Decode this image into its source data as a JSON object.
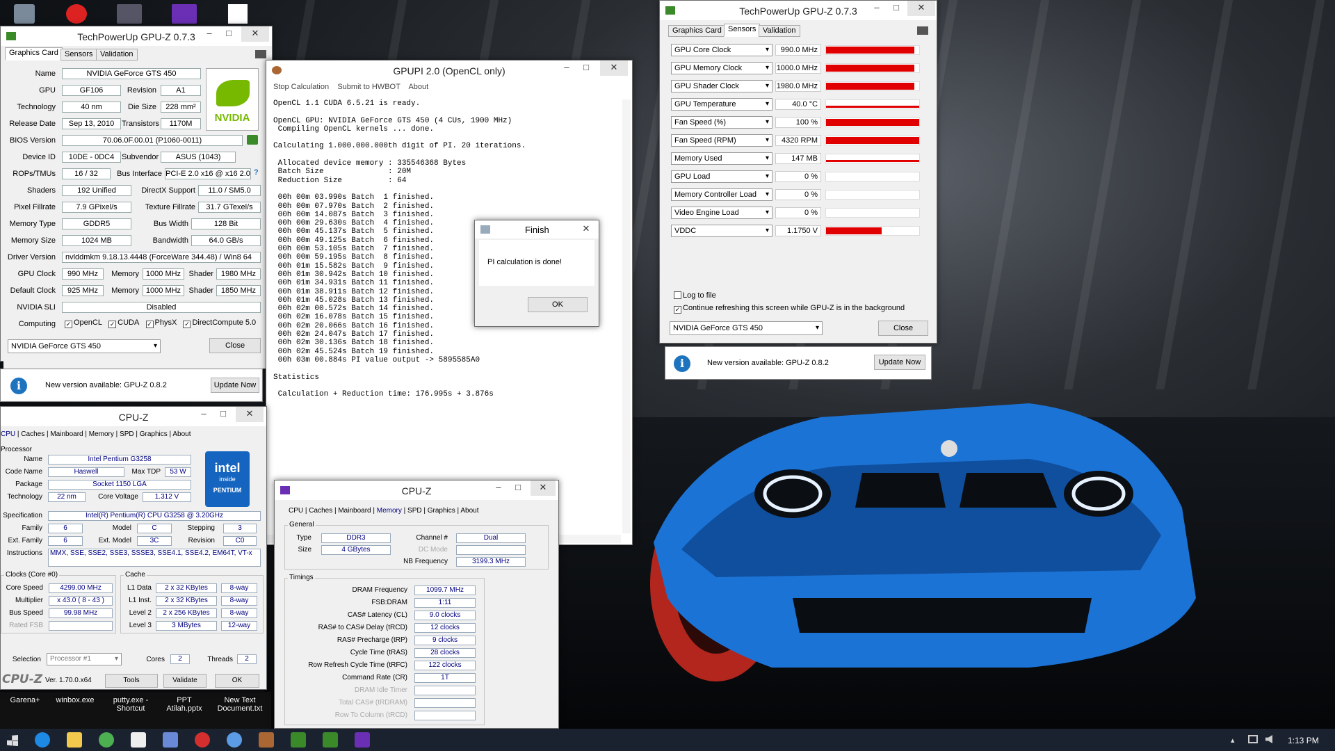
{
  "desktop": {
    "icons": [
      "Garena+",
      "winbox.exe",
      "putty.exe - Shortcut",
      "PPT Atilah.pptx",
      "New Text Document.txt"
    ]
  },
  "gpuz_left": {
    "title": "TechPowerUp GPU-Z 0.7.3",
    "tabs": [
      "Graphics Card",
      "Sensors",
      "Validation"
    ],
    "name": "NVIDIA GeForce GTS 450",
    "gpu": "GF106",
    "revision": "A1",
    "technology": "40 nm",
    "die_size": "228 mm²",
    "release_date": "Sep 13, 2010",
    "transistors": "1170M",
    "bios": "70.06.0F.00.01 (P1060-0011)",
    "device_id": "10DE - 0DC4",
    "subvendor": "ASUS (1043)",
    "rops": "16 / 32",
    "bus_interface": "PCI-E 2.0 x16 @ x16 2.0",
    "shaders": "192 Unified",
    "directx": "11.0 / SM5.0",
    "pixel_fillrate": "7.9 GPixel/s",
    "texture_fillrate": "31.7 GTexel/s",
    "memory_type": "GDDR5",
    "bus_width": "128 Bit",
    "memory_size": "1024 MB",
    "bandwidth": "64.0 GB/s",
    "driver": "nvlddmkm 9.18.13.4448 (ForceWare 344.48) / Win8 64",
    "gpu_clock": "990 MHz",
    "mem_clock": "1000 MHz",
    "shader_clock": "1980 MHz",
    "def_clock": "925 MHz",
    "def_mem": "1000 MHz",
    "def_shader": "1850 MHz",
    "sli": "Disabled",
    "labels": {
      "name": "Name",
      "gpu": "GPU",
      "revision": "Revision",
      "technology": "Technology",
      "die": "Die Size",
      "release": "Release Date",
      "transistors": "Transistors",
      "bios": "BIOS Version",
      "device": "Device ID",
      "subvendor": "Subvendor",
      "rops": "ROPs/TMUs",
      "bus": "Bus Interface",
      "shaders": "Shaders",
      "directx": "DirectX Support",
      "pixel": "Pixel Fillrate",
      "texture": "Texture Fillrate",
      "memtype": "Memory Type",
      "buswidth": "Bus Width",
      "memsize": "Memory Size",
      "bandwidth": "Bandwidth",
      "driver": "Driver Version",
      "gpuclock": "GPU Clock",
      "memory": "Memory",
      "shader": "Shader",
      "default": "Default Clock",
      "sli": "NVIDIA SLI",
      "computing": "Computing"
    },
    "computing": [
      "OpenCL",
      "CUDA",
      "PhysX",
      "DirectCompute 5.0"
    ],
    "selected": "NVIDIA GeForce GTS 450",
    "close": "Close",
    "update_text": "New version available: GPU-Z 0.8.2",
    "update_btn": "Update Now"
  },
  "gpupi": {
    "title": "GPUPI 2.0 (OpenCL only)",
    "menu": [
      "Stop Calculation",
      "Submit to HWBOT",
      "About"
    ],
    "log": "OpenCL 1.1 CUDA 6.5.21 is ready.\n\nOpenCL GPU: NVIDIA GeForce GTS 450 (4 CUs, 1900 MHz)\n Compiling OpenCL kernels ... done.\n\nCalculating 1.000.000.000th digit of PI. 20 iterations.\n\n Allocated device memory : 335546368 Bytes\n Batch Size              : 20M\n Reduction Size          : 64\n\n 00h 00m 03.990s Batch  1 finished.\n 00h 00m 07.970s Batch  2 finished.\n 00h 00m 14.087s Batch  3 finished.\n 00h 00m 29.630s Batch  4 finished.\n 00h 00m 45.137s Batch  5 finished.\n 00h 00m 49.125s Batch  6 finished.\n 00h 00m 53.105s Batch  7 finished.\n 00h 00m 59.195s Batch  8 finished.\n 00h 01m 15.582s Batch  9 finished.\n 00h 01m 30.942s Batch 10 finished.\n 00h 01m 34.931s Batch 11 finished.\n 00h 01m 38.911s Batch 12 finished.\n 00h 01m 45.028s Batch 13 finished.\n 00h 02m 00.572s Batch 14 finished.\n 00h 02m 16.078s Batch 15 finished.\n 00h 02m 20.066s Batch 16 finished.\n 00h 02m 24.047s Batch 17 finished.\n 00h 02m 30.136s Batch 18 finished.\n 00h 02m 45.524s Batch 19 finished.\n 00h 03m 00.884s PI value output -> 5895585A0\n\nStatistics\n\n Calculation + Reduction time: 176.995s + 3.876s"
  },
  "finish": {
    "title": "Finish",
    "message": "PI calculation is done!",
    "ok": "OK"
  },
  "gpuz_right": {
    "title": "TechPowerUp GPU-Z 0.7.3",
    "tabs": [
      "Graphics Card",
      "Sensors",
      "Validation"
    ],
    "sensors": [
      {
        "name": "GPU Core Clock",
        "value": "990.0 MHz",
        "fill": 0.95
      },
      {
        "name": "GPU Memory Clock",
        "value": "1000.0 MHz",
        "fill": 0.95
      },
      {
        "name": "GPU Shader Clock",
        "value": "1980.0 MHz",
        "fill": 0.95
      },
      {
        "name": "GPU Temperature",
        "value": "40.0 °C",
        "fill": 0.15
      },
      {
        "name": "Fan Speed (%)",
        "value": "100 %",
        "fill": 1.0
      },
      {
        "name": "Fan Speed (RPM)",
        "value": "4320 RPM",
        "fill": 1.0
      },
      {
        "name": "Memory Used",
        "value": "147 MB",
        "fill": 0.15
      },
      {
        "name": "GPU Load",
        "value": "0 %",
        "fill": 0
      },
      {
        "name": "Memory Controller Load",
        "value": "0 %",
        "fill": 0
      },
      {
        "name": "Video Engine Load",
        "value": "0 %",
        "fill": 0
      },
      {
        "name": "VDDC",
        "value": "1.1750 V",
        "fill": 0.6
      }
    ],
    "log_to_file": "Log to file",
    "refresh": "Continue refreshing this screen while GPU-Z is in the background",
    "selected": "NVIDIA GeForce GTS 450",
    "close": "Close",
    "update_text": "New version available: GPU-Z 0.8.2",
    "update_btn": "Update Now"
  },
  "cpuz_cpu": {
    "title": "CPU-Z",
    "tabs": [
      "CPU",
      "Caches",
      "Mainboard",
      "Memory",
      "SPD",
      "Graphics",
      "About"
    ],
    "processor": "Processor",
    "name": "Intel Pentium G3258",
    "code_name": "Haswell",
    "max_tdp": "53 W",
    "package": "Socket 1150 LGA",
    "technology": "22 nm",
    "core_voltage": "1.312 V",
    "specification": "Intel(R) Pentium(R) CPU G3258 @ 3.20GHz",
    "family": "6",
    "model": "C",
    "stepping": "3",
    "ext_family": "6",
    "ext_model": "3C",
    "revision": "C0",
    "instructions": "MMX, SSE, SSE2, SSE3, SSSE3, SSE4.1, SSE4.2, EM64T, VT-x",
    "clocks_title": "Clocks (Core #0)",
    "core_speed": "4299.00 MHz",
    "multiplier": "x 43.0 ( 8 - 43 )",
    "bus_speed": "99.98 MHz",
    "rated_fsb": "Rated FSB",
    "cache_title": "Cache",
    "l1d": "2 x 32 KBytes",
    "l1d_way": "8-way",
    "l1i": "2 x 32 KBytes",
    "l1i_way": "8-way",
    "l2": "2 x 256 KBytes",
    "l2_way": "8-way",
    "l3": "3 MBytes",
    "l3_way": "12-way",
    "selection": "Processor #1",
    "cores": "2",
    "threads": "2",
    "labels": {
      "name": "Name",
      "code": "Code Name",
      "tdp": "Max TDP",
      "package": "Package",
      "technology": "Technology",
      "voltage": "Core Voltage",
      "spec": "Specification",
      "family": "Family",
      "model": "Model",
      "stepping": "Stepping",
      "extfam": "Ext. Family",
      "extmodel": "Ext. Model",
      "revision": "Revision",
      "instr": "Instructions",
      "corespeed": "Core Speed",
      "mult": "Multiplier",
      "bus": "Bus Speed",
      "l1d": "L1 Data",
      "l1i": "L1 Inst.",
      "l2": "Level 2",
      "l3": "Level 3",
      "selection": "Selection",
      "cores": "Cores",
      "threads": "Threads"
    },
    "logo": "CPU-Z",
    "version": "Ver. 1.70.0.x64",
    "tools": "Tools",
    "validate": "Validate",
    "ok": "OK",
    "intel_logo": "intel",
    "intel_inside": "inside",
    "intel_brand": "PENTIUM"
  },
  "cpuz_mem": {
    "title": "CPU-Z",
    "tabs": [
      "CPU",
      "Caches",
      "Mainboard",
      "Memory",
      "SPD",
      "Graphics",
      "About"
    ],
    "general": "General",
    "type": "DDR3",
    "size": "4 GBytes",
    "channel": "Dual",
    "dc_mode": "DC Mode",
    "nb_freq": "3199.3 MHz",
    "timings_title": "Timings",
    "labels": {
      "type": "Type",
      "size": "Size",
      "channel": "Channel #",
      "nbfreq": "NB Frequency"
    },
    "timings": [
      {
        "label": "DRAM Frequency",
        "value": "1099.7 MHz"
      },
      {
        "label": "FSB:DRAM",
        "value": "1:11"
      },
      {
        "label": "CAS# Latency (CL)",
        "value": "9.0 clocks"
      },
      {
        "label": "RAS# to CAS# Delay (tRCD)",
        "value": "12 clocks"
      },
      {
        "label": "RAS# Precharge (tRP)",
        "value": "9 clocks"
      },
      {
        "label": "Cycle Time (tRAS)",
        "value": "28 clocks"
      },
      {
        "label": "Row Refresh Cycle Time (tRFC)",
        "value": "122 clocks"
      },
      {
        "label": "Command Rate (CR)",
        "value": "1T"
      },
      {
        "label": "DRAM Idle Timer",
        "value": ""
      },
      {
        "label": "Total CAS# (tRDRAM)",
        "value": ""
      },
      {
        "label": "Row To Column (tRCD)",
        "value": ""
      }
    ]
  },
  "taskbar": {
    "time": "1:13 PM"
  }
}
